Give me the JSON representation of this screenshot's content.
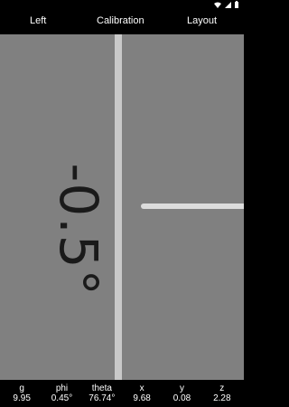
{
  "toolbar": {
    "left_label": "Left",
    "calibration_label": "Calibration",
    "layout_label": "Layout"
  },
  "level": {
    "angle": "-0.5°"
  },
  "sensors": [
    {
      "label": "g",
      "value": "9.95"
    },
    {
      "label": "phi",
      "value": "0.45°"
    },
    {
      "label": "theta",
      "value": "76.74°"
    },
    {
      "label": "x",
      "value": "9.68"
    },
    {
      "label": "y",
      "value": "0.08"
    },
    {
      "label": "z",
      "value": "2.28"
    }
  ],
  "status": {
    "icons": [
      "wifi-icon",
      "signal-icon",
      "battery-icon"
    ]
  },
  "colors": {
    "background": "#808080",
    "level_line": "#c9c9c9",
    "bars": "#000000"
  }
}
